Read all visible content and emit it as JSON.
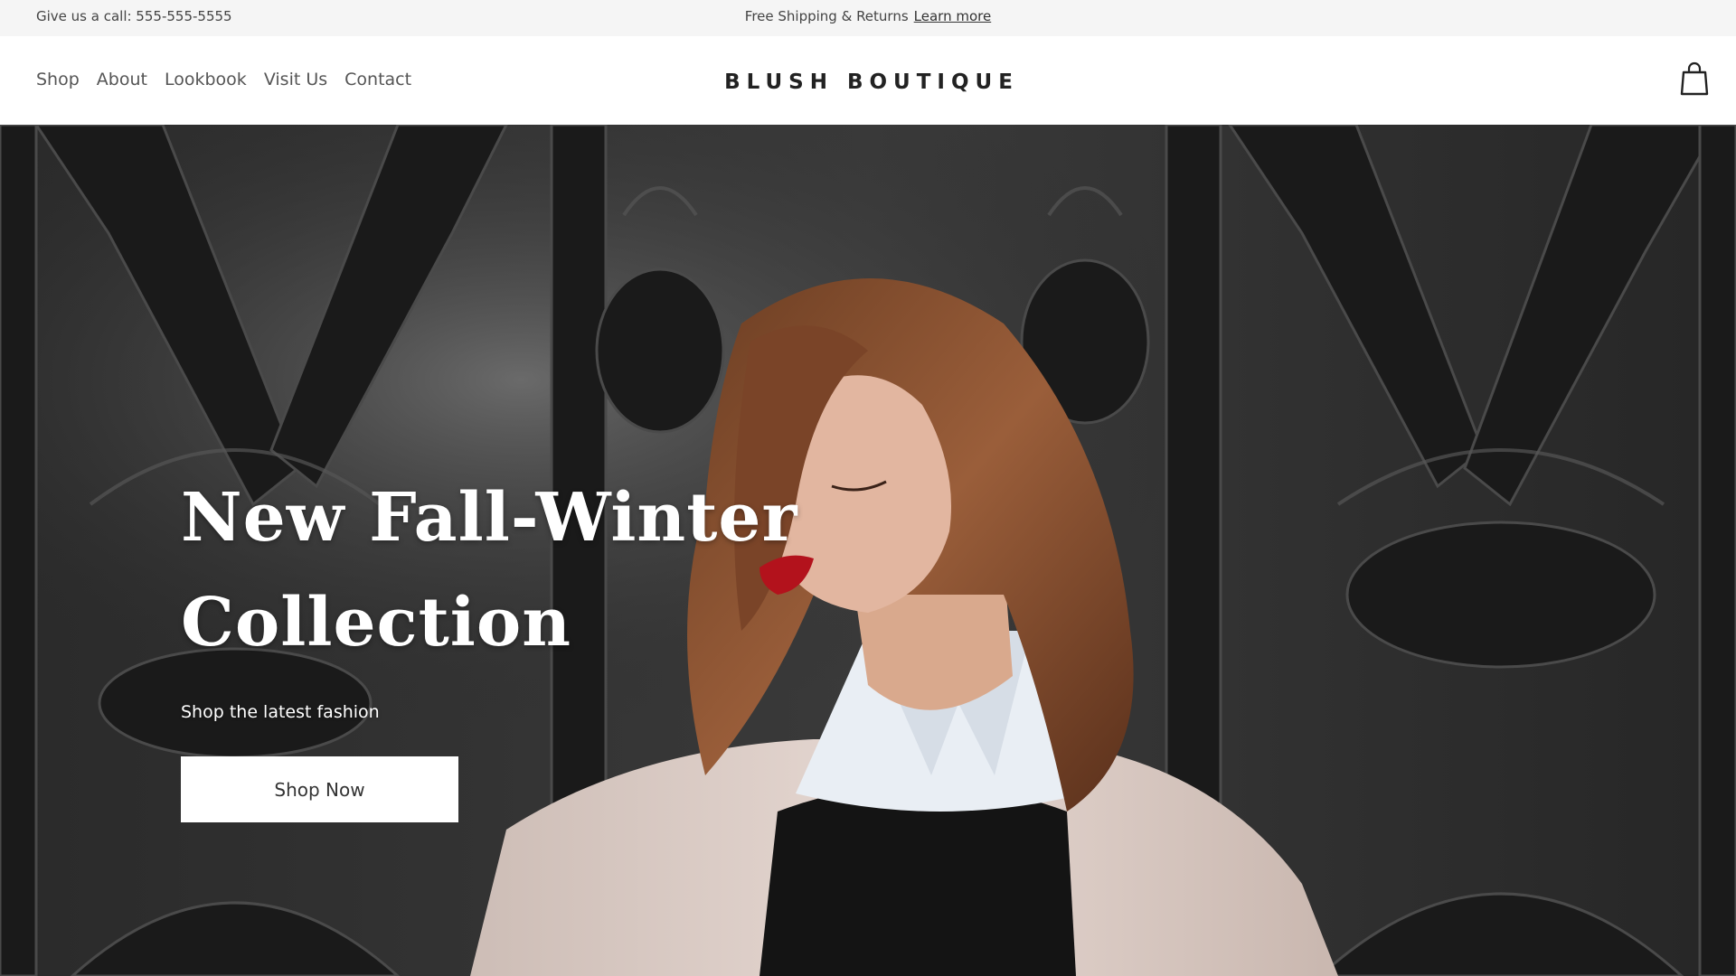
{
  "topbar": {
    "phone": "Give us a call: 555-555-5555",
    "promo": "Free Shipping & Returns",
    "learn_more": "Learn more"
  },
  "header": {
    "nav": [
      "Shop",
      "About",
      "Lookbook",
      "Visit Us",
      "Contact"
    ],
    "brand": "BLUSH BOUTIQUE",
    "cart_icon": "shopping-bag-icon"
  },
  "hero": {
    "title_line1": "New Fall-Winter",
    "title_line2": "Collection",
    "subtitle": "Shop the latest fashion",
    "cta": "Shop Now"
  },
  "colors": {
    "topbar_bg": "#f5f5f5",
    "header_bg": "#ffffff",
    "hero_text": "#ffffff",
    "button_bg": "#ffffff",
    "lip_red": "#b3121c",
    "hair": "#8a5233"
  }
}
